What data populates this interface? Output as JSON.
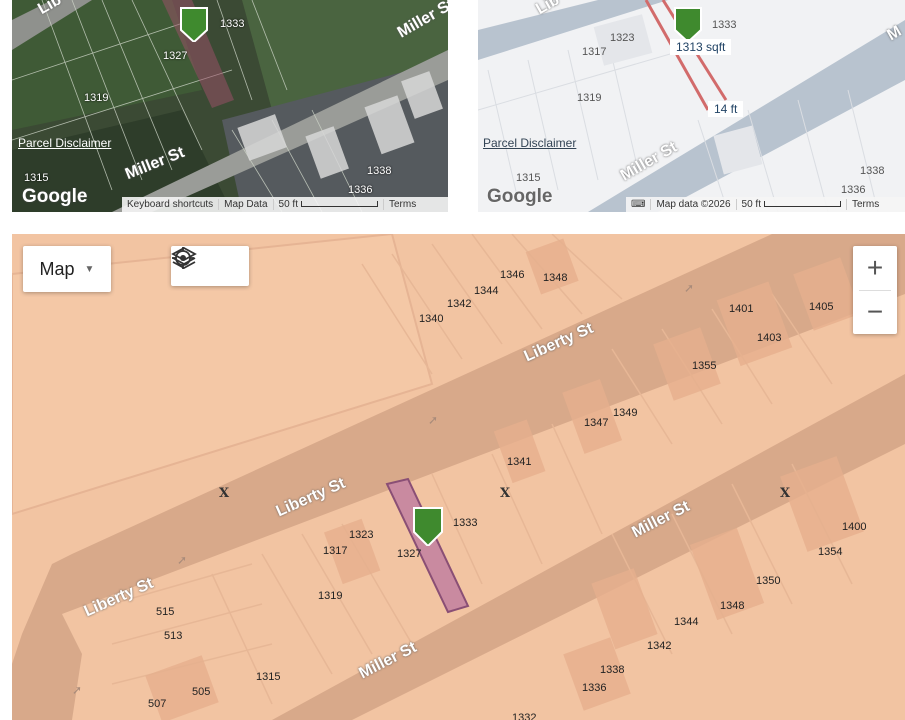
{
  "satellite": {
    "parcels": [
      "1333",
      "1327",
      "1319",
      "1315",
      "1338",
      "1336"
    ],
    "streets": [
      "Miller St",
      "Miller St",
      "Lib"
    ],
    "logo": "Google",
    "disclaimer": "Parcel Disclaimer",
    "attribution": [
      "Keyboard shortcuts",
      "Map Data",
      "50 ft",
      "Terms"
    ]
  },
  "street": {
    "parcels": [
      "1323",
      "1333",
      "1317",
      "1319",
      "1315",
      "1338",
      "1336"
    ],
    "streets": [
      "Miller St",
      "Lib",
      "M"
    ],
    "area": "1313 sqft",
    "width": "14 ft",
    "logo": "Google",
    "disclaimer": "Parcel Disclaimer",
    "attribution": [
      "Map data ©2026",
      "50 ft",
      "Terms"
    ]
  },
  "zoning": {
    "map_type": "Map",
    "zoom_in": "+",
    "zoom_out": "−",
    "streets": [
      "Liberty St",
      "Liberty St",
      "Liberty St",
      "Miller St",
      "Miller St"
    ],
    "parcels": [
      "1346",
      "1348",
      "1344",
      "1342",
      "1340",
      "1401",
      "1405",
      "1403",
      "1355",
      "1349",
      "1347",
      "1341",
      "1333",
      "1323",
      "1317",
      "1327",
      "1319",
      "515",
      "513",
      "507",
      "505",
      "1315",
      "1400",
      "1354",
      "1350",
      "1348",
      "1344",
      "1342",
      "1338",
      "1336",
      "1332"
    ],
    "x_marker": "X",
    "colors": {
      "zone": "#f2c4a2",
      "road": "#d8a98a",
      "selected_parcel": "#c98aa0",
      "pin": "#3f8a2e"
    }
  }
}
